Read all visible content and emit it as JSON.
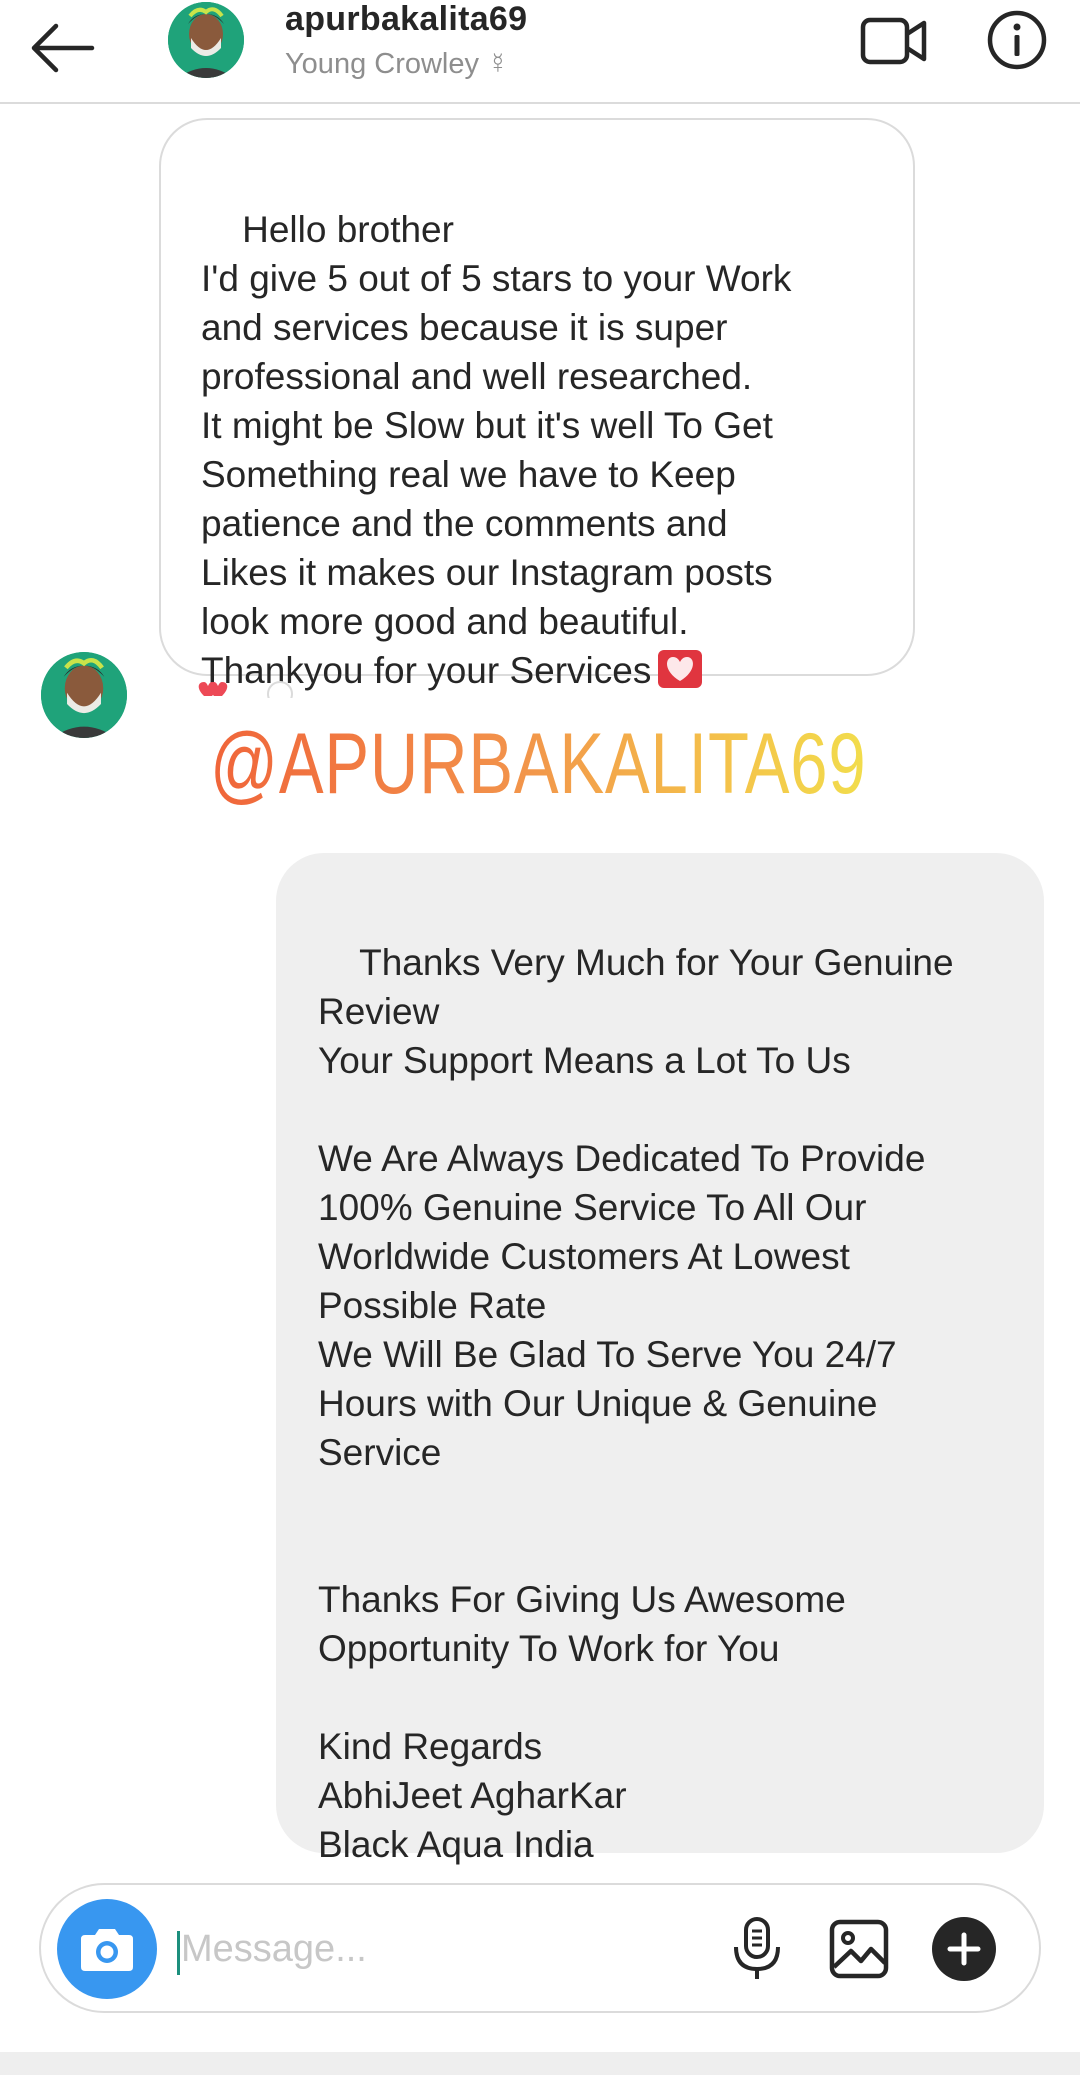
{
  "header": {
    "username": "apurbakalita69",
    "display_name": "Young Crowley ☿",
    "icons": [
      "back-arrow-icon",
      "video-call-icon",
      "info-icon"
    ]
  },
  "messages": [
    {
      "direction": "incoming",
      "text": "Hello brother\nI'd give 5 out of 5 stars to your Work\nand services because it is super\nprofessional and well researched.\nIt might be Slow but it's well To Get\nSomething real we have to Keep\npatience and the comments and\nLikes it makes our Instagram posts\nlook more good and beautiful.\nThankyou for your Services",
      "emoji": "heart-letter-emoji"
    },
    {
      "direction": "outgoing",
      "text": "Thanks Very Much for Your Genuine\nReview\nYour Support Means a Lot To Us\n\nWe Are Always Dedicated To Provide\n100% Genuine Service To All Our\nWorldwide Customers At Lowest\nPossible Rate\nWe Will Be Glad To Serve You 24/7\nHours with Our Unique & Genuine\nService\n\n\nThanks For Giving Us Awesome\nOpportunity To Work for You\n\nKind Regards\nAbhiJeet AgharKar\nBlack Aqua India"
    }
  ],
  "overlay": {
    "watermark": "@APURBAKALITA69"
  },
  "composer": {
    "placeholder": "Message...",
    "value": "",
    "icons": [
      "camera-icon",
      "microphone-icon",
      "gallery-icon",
      "plus-icon"
    ]
  },
  "colors": {
    "accent_blue": "#3897f0",
    "outgoing_bubble": "#efefef",
    "border": "#dbdbdb",
    "watermark_start": "#f0653a",
    "watermark_end": "#f2dd4c"
  }
}
